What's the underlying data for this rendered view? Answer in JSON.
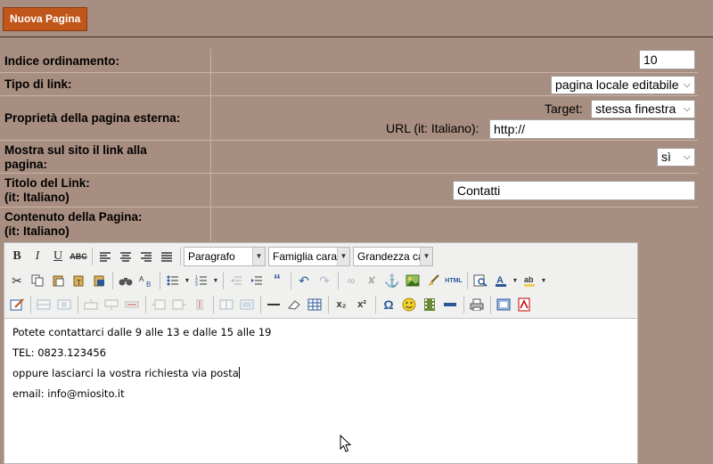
{
  "header": {
    "new_page_button": "Nuova Pagina"
  },
  "form": {
    "order_index": {
      "label": "Indice ordinamento:",
      "value": "10"
    },
    "link_type": {
      "label": "Tipo di link:",
      "selected": "pagina locale editabile"
    },
    "external_page": {
      "label": "Proprietà della pagina esterna:",
      "target_label": "Target:",
      "target_selected": "stessa finestra",
      "url_label": "URL (it: Italiano):",
      "url_value": "http://"
    },
    "show_link": {
      "label_line1": "Mostra sul sito il link alla",
      "label_line2": "pagina:",
      "selected": "sì"
    },
    "link_title": {
      "label_line1": "Titolo del Link:",
      "label_line2": "(it: Italiano)",
      "value": "Contatti"
    },
    "page_content": {
      "label_line1": "Contenuto della Pagina:",
      "label_line2": "(it: Italiano)"
    }
  },
  "editor": {
    "toolbar": {
      "bold": "B",
      "italic": "I",
      "underline": "U",
      "strike": "ABC",
      "format_select": "Paragrafo",
      "font_family_select": "Famiglia caratt",
      "font_size_select": "Grandezza car",
      "html_button": "HTML",
      "omega": "Ω",
      "sub": "x₂",
      "sup": "x²"
    },
    "content_lines": [
      "Potete contattarci dalle 9 alle 13 e dalle 15 alle 19",
      "TEL: 0823.123456",
      "oppure lasciarci la vostra richiesta via posta",
      "email: info@miosito.it"
    ]
  }
}
